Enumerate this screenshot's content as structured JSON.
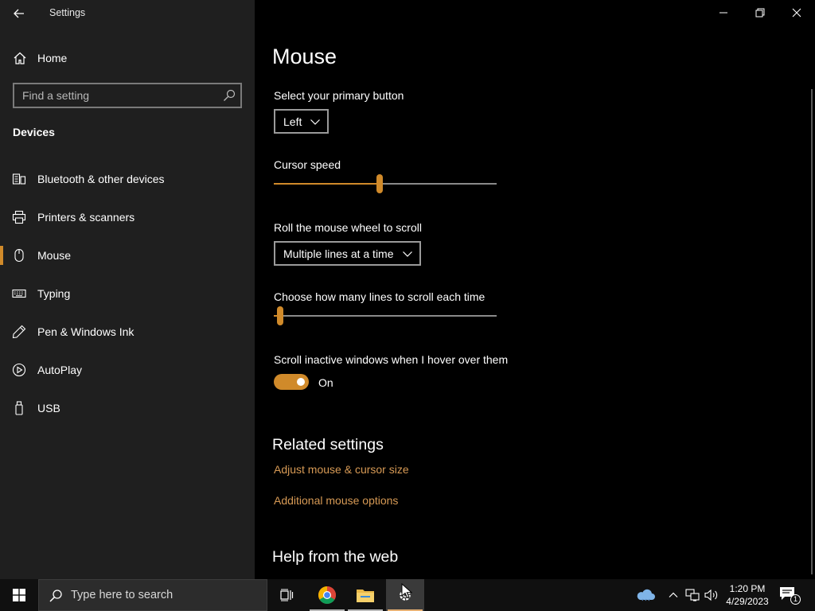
{
  "window": {
    "title": "Settings"
  },
  "sidebar": {
    "home_label": "Home",
    "search_placeholder": "Find a setting",
    "section": "Devices",
    "items": [
      {
        "label": "Bluetooth & other devices",
        "icon": "bluetooth-devices-icon"
      },
      {
        "label": "Printers & scanners",
        "icon": "printer-icon"
      },
      {
        "label": "Mouse",
        "icon": "mouse-icon",
        "active": true
      },
      {
        "label": "Typing",
        "icon": "keyboard-icon"
      },
      {
        "label": "Pen & Windows Ink",
        "icon": "pen-icon"
      },
      {
        "label": "AutoPlay",
        "icon": "autoplay-icon"
      },
      {
        "label": "USB",
        "icon": "usb-icon"
      }
    ]
  },
  "main": {
    "title": "Mouse",
    "primary_button": {
      "label": "Select your primary button",
      "value": "Left"
    },
    "cursor_speed": {
      "label": "Cursor speed",
      "level": 0.475
    },
    "wheel_scroll": {
      "label": "Roll the mouse wheel to scroll",
      "value": "Multiple lines at a time"
    },
    "lines_to_scroll": {
      "label": "Choose how many lines to scroll each time",
      "level": 0.03
    },
    "inactive_scroll": {
      "label": "Scroll inactive windows when I hover over them",
      "state": "On"
    },
    "related": {
      "title": "Related settings",
      "links": [
        "Adjust mouse & cursor size",
        "Additional mouse options"
      ]
    },
    "help": {
      "title": "Help from the web"
    }
  },
  "taskbar": {
    "search_placeholder": "Type here to search",
    "time": "1:20 PM",
    "date": "4/29/2023",
    "notification_count": "1"
  },
  "colors": {
    "accent": "#d08a2a",
    "link": "#d79a55",
    "sidebar_bg": "#1f1f1f",
    "main_bg": "#000000",
    "taskbar_bg": "#101010"
  }
}
